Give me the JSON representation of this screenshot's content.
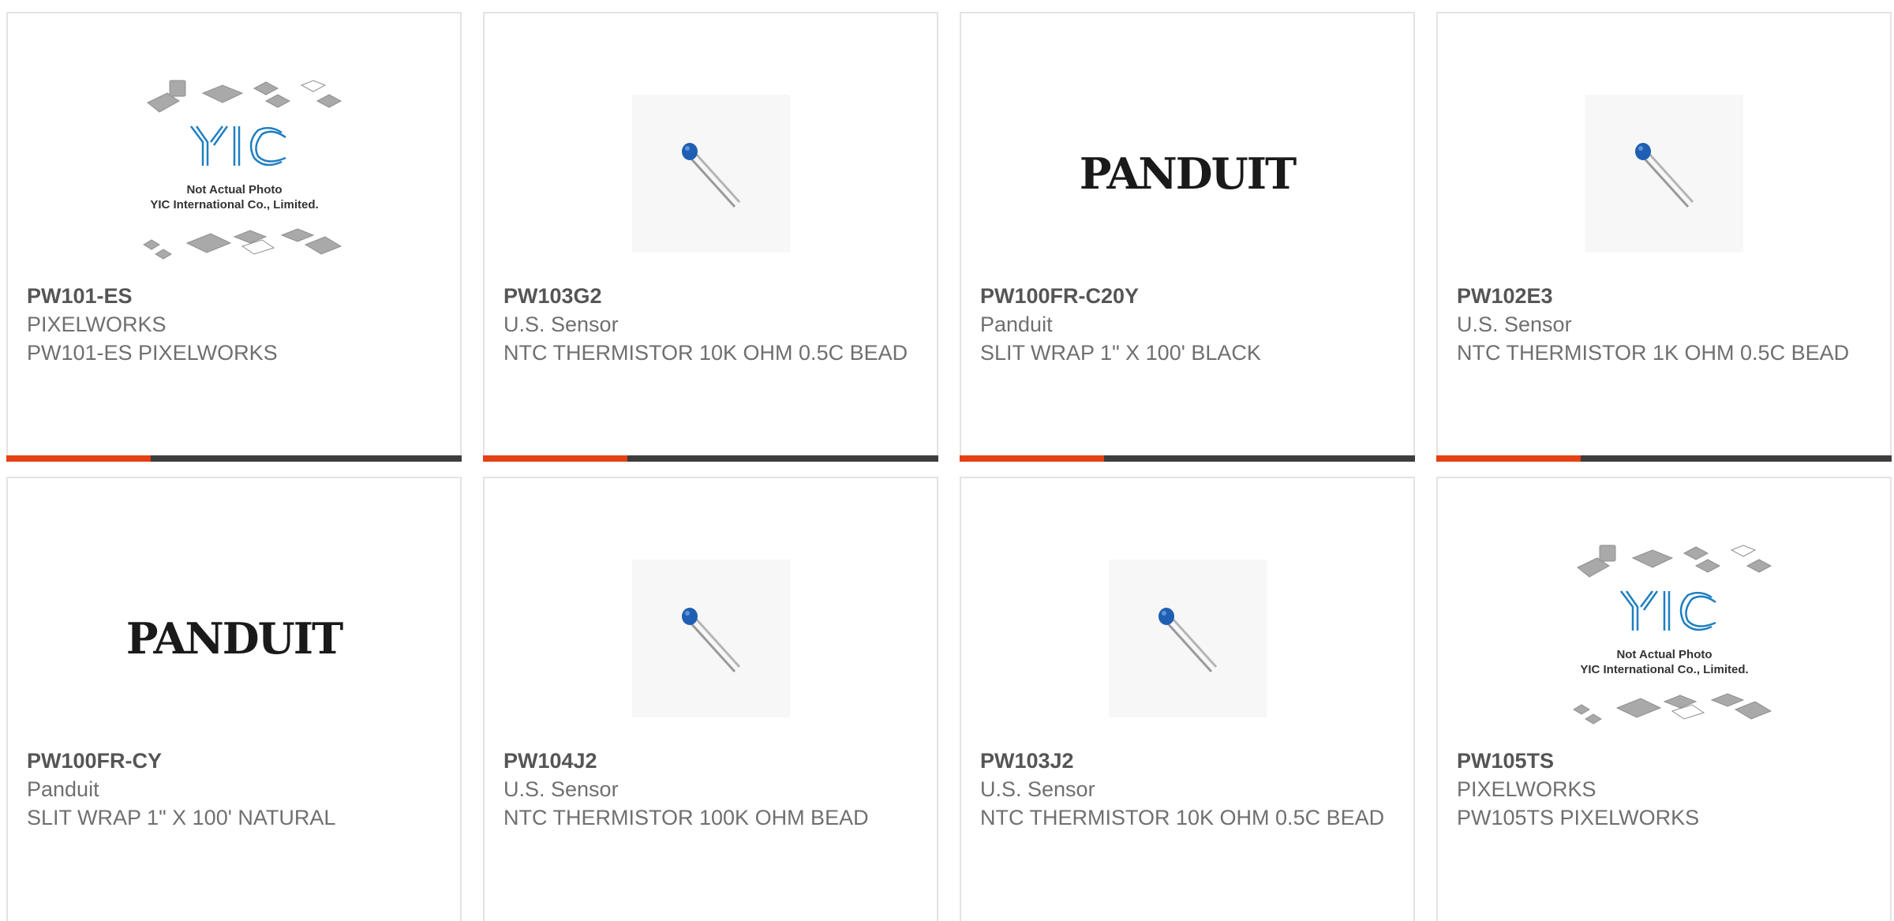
{
  "colors": {
    "accent": "#e53f14",
    "bar_dark": "#3d3d3d",
    "card_border": "#e3e3e3",
    "part_number_text": "#555555",
    "body_text": "#6f6f6f"
  },
  "products": [
    {
      "part_number": "PW101-ES",
      "manufacturer": "PIXELWORKS",
      "description": "PW101-ES PIXELWORKS",
      "image_type": "placeholder",
      "placeholder_brand": "YIC",
      "placeholder_line1": "Not Actual Photo",
      "placeholder_line2": "YIC International Co., Limited."
    },
    {
      "part_number": "PW103G2",
      "manufacturer": "U.S. Sensor",
      "description": "NTC THERMISTOR 10K OHM 0.5C BEAD",
      "image_type": "thermistor"
    },
    {
      "part_number": "PW100FR-C20Y",
      "manufacturer": "Panduit",
      "description": "SLIT WRAP 1\" X 100' BLACK",
      "image_type": "panduit-logo"
    },
    {
      "part_number": "PW102E3",
      "manufacturer": "U.S. Sensor",
      "description": "NTC THERMISTOR 1K OHM 0.5C BEAD",
      "image_type": "thermistor"
    },
    {
      "part_number": "PW100FR-CY",
      "manufacturer": "Panduit",
      "description": "SLIT WRAP 1\" X 100' NATURAL",
      "image_type": "panduit-logo"
    },
    {
      "part_number": "PW104J2",
      "manufacturer": "U.S. Sensor",
      "description": "NTC THERMISTOR 100K OHM BEAD",
      "image_type": "thermistor"
    },
    {
      "part_number": "PW103J2",
      "manufacturer": "U.S. Sensor",
      "description": "NTC THERMISTOR 10K OHM 0.5C BEAD",
      "image_type": "thermistor"
    },
    {
      "part_number": "PW105TS",
      "manufacturer": "PIXELWORKS",
      "description": "PW105TS PIXELWORKS",
      "image_type": "placeholder",
      "placeholder_brand": "YIC",
      "placeholder_line1": "Not Actual Photo",
      "placeholder_line2": "YIC International Co., Limited."
    }
  ],
  "logos": {
    "panduit": "PANDUIT"
  }
}
